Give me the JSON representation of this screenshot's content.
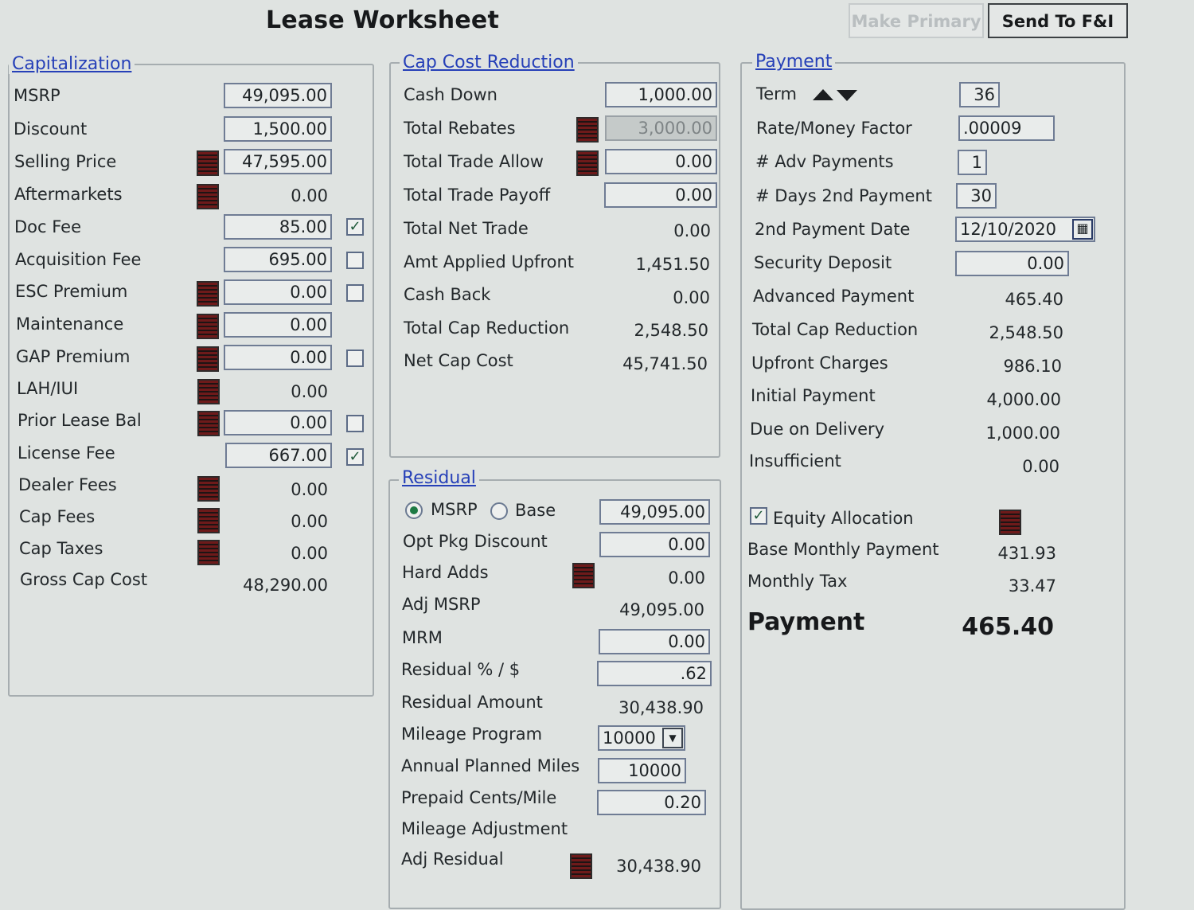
{
  "title": "Lease Worksheet",
  "buttons": {
    "make_primary": "Make Primary",
    "send_to_fi": "Send To F&I"
  },
  "capitalization": {
    "legend": "Capitalization",
    "msrp": {
      "label": "MSRP",
      "value": "49,095.00"
    },
    "discount": {
      "label": "Discount",
      "value": "1,500.00"
    },
    "selling_price": {
      "label": "Selling Price",
      "value": "47,595.00"
    },
    "aftermarkets": {
      "label": "Aftermarkets",
      "value": "0.00"
    },
    "doc_fee": {
      "label": "Doc Fee",
      "value": "85.00",
      "checked": true
    },
    "acquisition_fee": {
      "label": "Acquisition Fee",
      "value": "695.00",
      "checked": false
    },
    "esc_premium": {
      "label": "ESC Premium",
      "value": "0.00",
      "checked": false
    },
    "maintenance": {
      "label": "Maintenance",
      "value": "0.00"
    },
    "gap_premium": {
      "label": "GAP Premium",
      "value": "0.00",
      "checked": false
    },
    "lah_iui": {
      "label": "LAH/IUI",
      "value": "0.00"
    },
    "prior_lease_bal": {
      "label": "Prior Lease Bal",
      "value": "0.00",
      "checked": false
    },
    "license_fee": {
      "label": "License Fee",
      "value": "667.00",
      "checked": true
    },
    "dealer_fees": {
      "label": "Dealer Fees",
      "value": "0.00"
    },
    "cap_fees": {
      "label": "Cap Fees",
      "value": "0.00"
    },
    "cap_taxes": {
      "label": "Cap Taxes",
      "value": "0.00"
    },
    "gross_cap_cost": {
      "label": "Gross Cap Cost",
      "value": "48,290.00"
    }
  },
  "cap_cost_reduction": {
    "legend": "Cap Cost Reduction",
    "cash_down": {
      "label": "Cash Down",
      "value": "1,000.00"
    },
    "total_rebates": {
      "label": "Total Rebates",
      "value": "3,000.00"
    },
    "total_trade_allow": {
      "label": "Total Trade Allow",
      "value": "0.00"
    },
    "total_trade_payoff": {
      "label": "Total Trade Payoff",
      "value": "0.00"
    },
    "total_net_trade": {
      "label": "Total Net Trade",
      "value": "0.00"
    },
    "amt_applied_upfront": {
      "label": "Amt Applied Upfront",
      "value": "1,451.50"
    },
    "cash_back": {
      "label": "Cash Back",
      "value": "0.00"
    },
    "total_cap_reduction": {
      "label": "Total Cap Reduction",
      "value": "2,548.50"
    },
    "net_cap_cost": {
      "label": "Net Cap Cost",
      "value": "45,741.50"
    }
  },
  "residual": {
    "legend": "Residual",
    "radio_msrp": "MSRP",
    "radio_base": "Base",
    "msrp_value": "49,095.00",
    "opt_pkg_discount": {
      "label": "Opt Pkg Discount",
      "value": "0.00"
    },
    "hard_adds": {
      "label": "Hard Adds",
      "value": "0.00"
    },
    "adj_msrp": {
      "label": "Adj MSRP",
      "value": "49,095.00"
    },
    "mrm": {
      "label": "MRM",
      "value": "0.00"
    },
    "residual_pct": {
      "label": "Residual % / $",
      "value": ".62"
    },
    "residual_amount": {
      "label": "Residual Amount",
      "value": "30,438.90"
    },
    "mileage_program": {
      "label": "Mileage Program",
      "value": "10000"
    },
    "annual_planned_miles": {
      "label": "Annual Planned Miles",
      "value": "10000"
    },
    "prepaid_cents_mile": {
      "label": "Prepaid Cents/Mile",
      "value": "0.20"
    },
    "mileage_adjustment": {
      "label": "Mileage Adjustment"
    },
    "adj_residual": {
      "label": "Adj Residual",
      "value": "30,438.90"
    }
  },
  "payment": {
    "legend": "Payment",
    "term": {
      "label": "Term",
      "value": "36"
    },
    "rate_money_factor": {
      "label": "Rate/Money Factor",
      "value": ".00009"
    },
    "adv_payments": {
      "label": "# Adv Payments",
      "value": "1"
    },
    "days_2nd_payment": {
      "label": "# Days 2nd Payment",
      "value": "30"
    },
    "second_payment_date": {
      "label": "2nd Payment Date",
      "value": "12/10/2020"
    },
    "security_deposit": {
      "label": "Security Deposit",
      "value": "0.00"
    },
    "advanced_payment": {
      "label": "Advanced Payment",
      "value": "465.40"
    },
    "total_cap_reduction": {
      "label": "Total Cap Reduction",
      "value": "2,548.50"
    },
    "upfront_charges": {
      "label": "Upfront Charges",
      "value": "986.10"
    },
    "initial_payment": {
      "label": "Initial Payment",
      "value": "4,000.00"
    },
    "due_on_delivery": {
      "label": "Due on Delivery",
      "value": "1,000.00"
    },
    "insufficient": {
      "label": "Insufficient",
      "value": "0.00"
    },
    "equity_allocation": {
      "label": "Equity Allocation",
      "checked": true
    },
    "base_monthly_payment": {
      "label": "Base Monthly Payment",
      "value": "431.93"
    },
    "monthly_tax": {
      "label": "Monthly Tax",
      "value": "33.47"
    },
    "payment_total": {
      "label": "Payment",
      "value": "465.40"
    }
  }
}
